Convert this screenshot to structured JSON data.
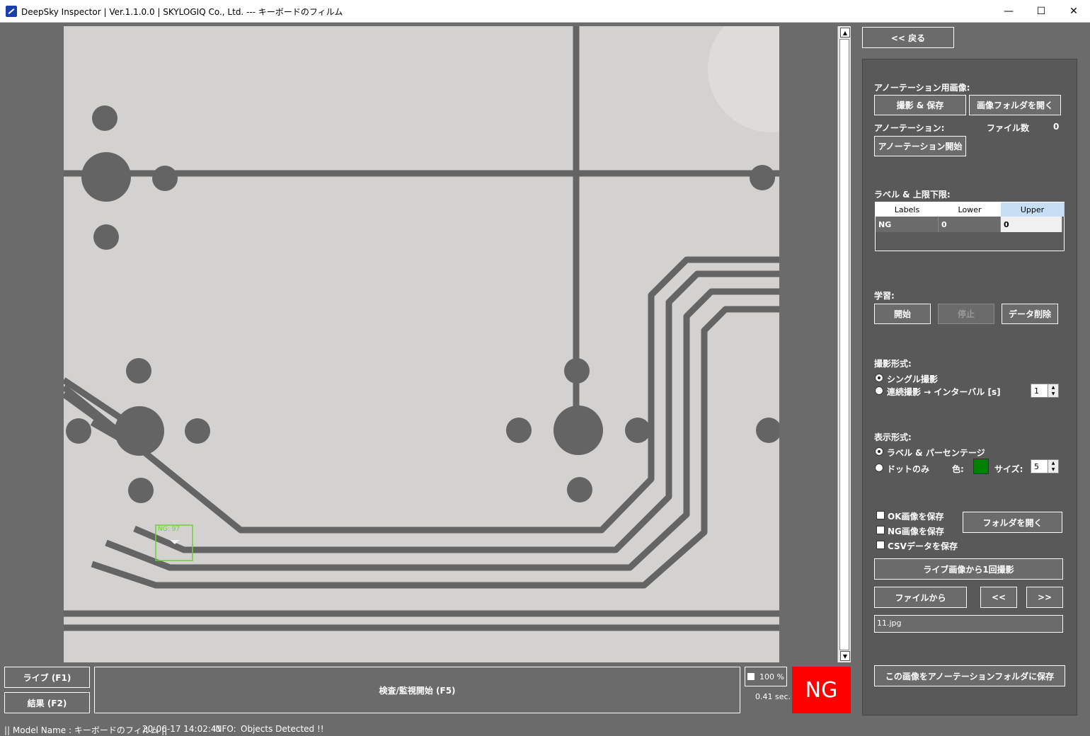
{
  "window": {
    "title": "DeepSky Inspector | Ver.1.1.0.0 | SKYLOGIQ Co., Ltd. --- キーボードのフィルム",
    "minimize": "—",
    "maximize": "☐",
    "close": "✕"
  },
  "viewer": {
    "detection_label": "NG: 97"
  },
  "bottom": {
    "live_button": "ライブ (F1)",
    "result_button": "結果 (F2)",
    "inspect_button": "検査/監視開始 (F5)",
    "zoom_percent": "100 %",
    "elapsed": "0.41 sec.",
    "verdict": "NG",
    "verdict_color": "#ff0000"
  },
  "status": {
    "model": "|| Model Name : キーボードのフィルム ||",
    "timestamp": "20-06-17 14:02:41",
    "info_label": "INFO:",
    "info_message": "Objects Detected !!"
  },
  "panel": {
    "back_button": "<< 戻る",
    "annotation_image_label": "アノーテーション用画像:",
    "capture_save_button": "撮影 & 保存",
    "open_image_folder_button": "画像フォルダを開く",
    "annotation_label": "アノーテーション:",
    "file_count_label": "ファイル数",
    "file_count_value": "0",
    "start_annotation_button": "アノーテーション開始",
    "label_limits_label": "ラベル & 上限下限:",
    "table": {
      "headers": [
        "Labels",
        "Lower",
        "Upper"
      ],
      "rows": [
        [
          "NG",
          "0",
          "0"
        ]
      ]
    },
    "learning_label": "学習:",
    "learn_start_button": "開始",
    "learn_stop_button": "停止",
    "data_delete_button": "データ削除",
    "capture_mode_label": "撮影形式:",
    "single_capture": "シングル撮影",
    "continuous_capture": "連続撮影 → インターバル [s]",
    "interval_value": "1",
    "display_mode_label": "表示形式:",
    "label_percentage": "ラベル & パーセンテージ",
    "dot_only": "ドットのみ",
    "color_label": "色:",
    "dot_color": "#008000",
    "size_label": "サイズ:",
    "size_value": "5",
    "save_ok": "OK画像を保存",
    "save_ng": "NG画像を保存",
    "save_csv": "CSVデータを保存",
    "open_folder_button": "フォルダを開く",
    "capture_once_button": "ライブ画像から1回撮影",
    "from_file_button": "ファイルから",
    "prev_button": "<<",
    "next_button": ">>",
    "filename": "11.jpg",
    "save_to_annotation_button": "この画像をアノーテーションフォルダに保存"
  }
}
